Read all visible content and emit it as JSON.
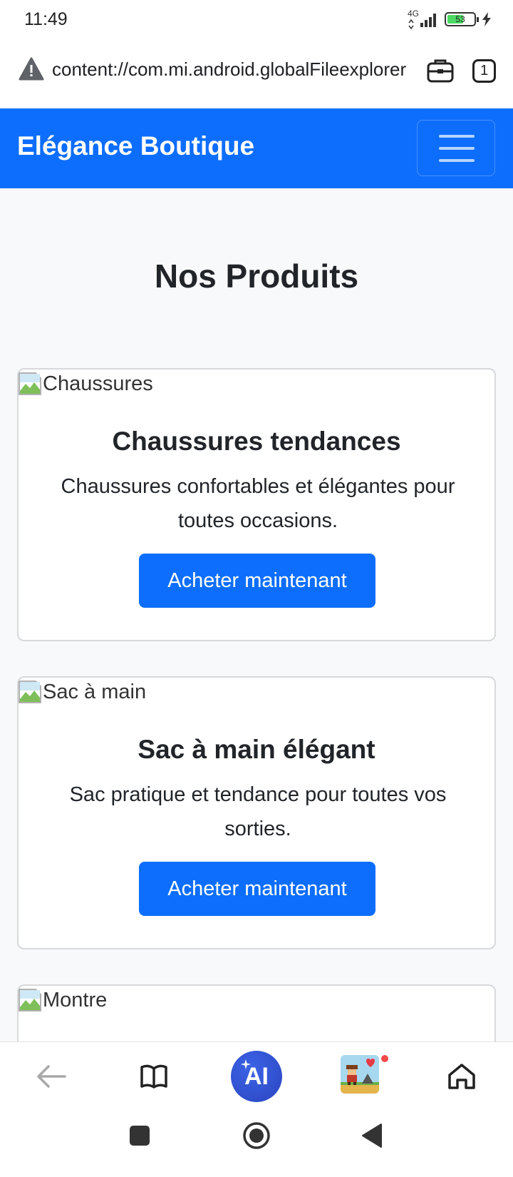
{
  "status": {
    "time": "11:49",
    "network": "4G",
    "battery": "53"
  },
  "browser": {
    "url": "content://com.mi.android.globalFileexplorer",
    "tab_count": "1"
  },
  "navbar": {
    "brand": "Elégance Boutique"
  },
  "main": {
    "title": "Nos Produits",
    "products": [
      {
        "image_alt": "Chaussures",
        "title": "Chaussures tendances",
        "description": "Chaussures confortables et élégantes pour toutes occasions.",
        "button": "Acheter maintenant"
      },
      {
        "image_alt": "Sac à main",
        "title": "Sac à main élégant",
        "description": "Sac pratique et tendance pour toutes vos sorties.",
        "button": "Acheter maintenant"
      },
      {
        "image_alt": "Montre"
      }
    ]
  },
  "bottom_nav": {
    "ai_label": "AI"
  },
  "colors": {
    "primary": "#0d6efd",
    "background": "#f8f9fa"
  }
}
